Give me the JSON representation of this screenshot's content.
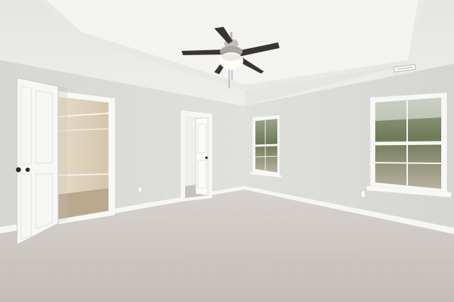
{
  "scene": {
    "colors": {
      "ceiling": "#eeeeec",
      "tray_ceiling": "#f4f4f2",
      "left_wall": "#d9d9d6",
      "back_wall": "#dcdcd9",
      "right_wall": "#d6d7d4",
      "carpet": "#cdc8c3",
      "trim": "#f7f7f5",
      "closet_interior": "#d8c9b0",
      "fan_blade": "#3a3431",
      "fan_metal": "#b8b6b2",
      "window_sky": "#f2f4f5",
      "window_trees": "#7d8766"
    },
    "icons": [
      "ceiling-fan-icon",
      "light-fixture-icon",
      "door-knob-icon",
      "air-vent-icon",
      "wall-outlet-icon"
    ]
  }
}
